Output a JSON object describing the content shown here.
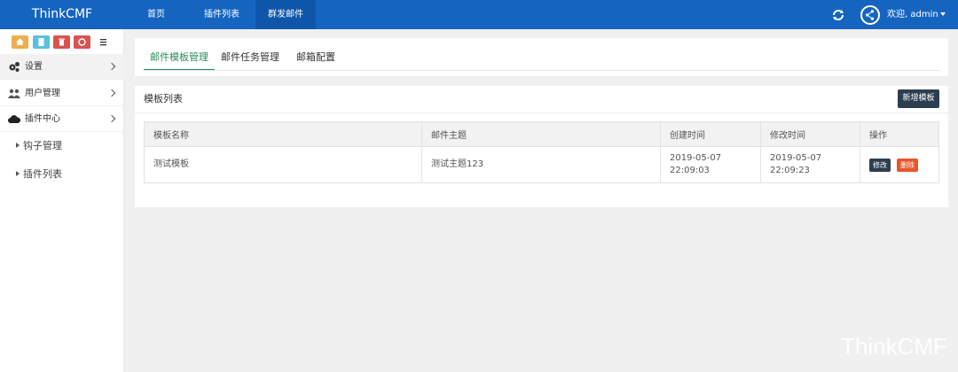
{
  "navbar": {
    "brand": "ThinkCMF",
    "links": [
      "首页",
      "插件列表",
      "群发邮件"
    ],
    "user_label": "欢迎, admin",
    "refresh_icon": "refresh-icon",
    "accent": "#1565c0"
  },
  "quick_buttons": [
    {
      "icon": "home-icon",
      "color": "#f0ad4e"
    },
    {
      "icon": "file-icon",
      "color": "#5bc0de"
    },
    {
      "icon": "trash-icon",
      "color": "#d9534f"
    },
    {
      "icon": "recycle-icon",
      "color": "#d9534f"
    },
    {
      "icon": "list-icon",
      "color": "#ffffff"
    }
  ],
  "sidebar": {
    "items": [
      {
        "label": "设置",
        "icon": "gears-icon"
      },
      {
        "label": "用户管理",
        "icon": "users-icon"
      },
      {
        "label": "插件中心",
        "icon": "cloud-icon"
      }
    ],
    "subitems": [
      "钩子管理",
      "插件列表"
    ]
  },
  "tabs": [
    "邮件模板管理",
    "邮件任务管理",
    "邮箱配置"
  ],
  "card": {
    "title": "模板列表",
    "add_button": "新增模板"
  },
  "table": {
    "headers": [
      "模板名称",
      "邮件主题",
      "创建时间",
      "修改时间",
      "操作"
    ],
    "rows": [
      {
        "name": "测试模板",
        "subject": "测试主题123",
        "created_date": "2019-05-07",
        "created_time": "22:09:03",
        "modified_date": "2019-05-07",
        "modified_time": "22:09:23",
        "edit": "修改",
        "delete": "删除"
      }
    ]
  },
  "watermark": "ThinkCMF"
}
